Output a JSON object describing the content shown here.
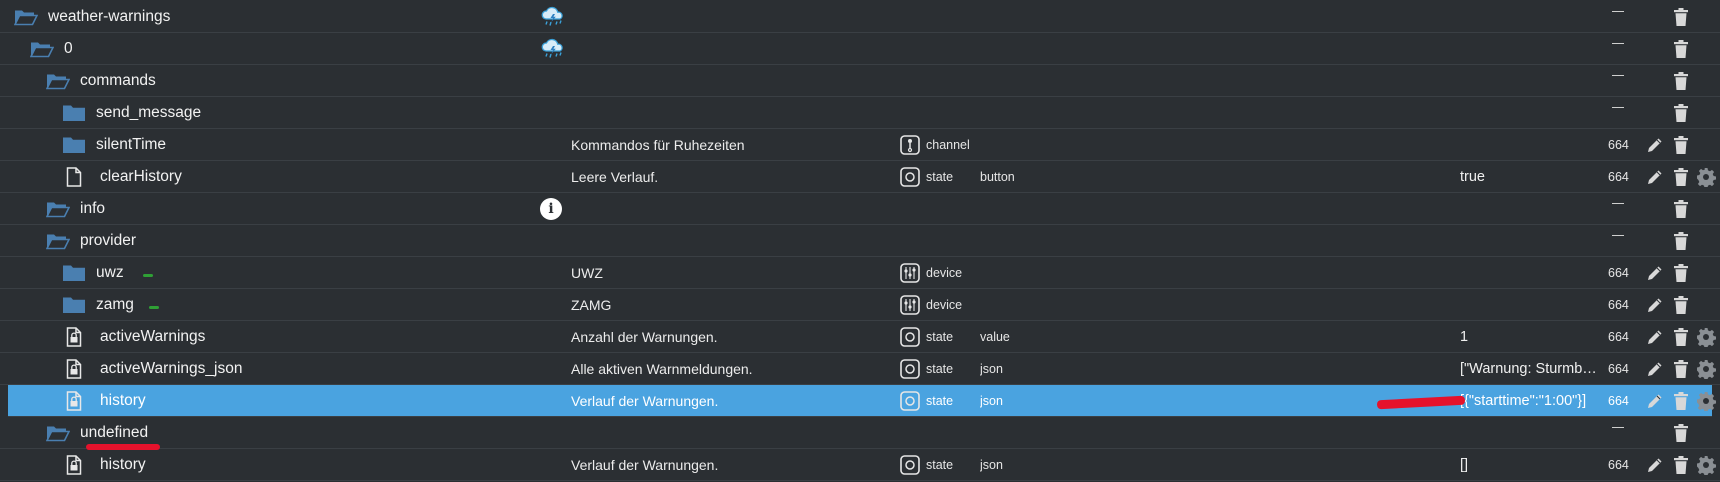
{
  "accent": "#4aa3e0",
  "annotation_color": "#e5122c",
  "rows": [
    {
      "name": "weather-warnings",
      "desc": "",
      "type": "",
      "role": "",
      "value": "",
      "acl": "",
      "icon": "folder-open-icon",
      "adapter_icon": "weather-icon"
    },
    {
      "name": "0",
      "desc": "",
      "type": "",
      "role": "",
      "value": "",
      "acl": "",
      "icon": "folder-open-icon",
      "adapter_icon": "weather-icon"
    },
    {
      "name": "commands",
      "desc": "",
      "type": "",
      "role": "",
      "value": "",
      "acl": "",
      "icon": "folder-open-icon"
    },
    {
      "name": "send_message",
      "desc": "",
      "type": "",
      "role": "",
      "value": "",
      "acl": "",
      "icon": "folder-icon"
    },
    {
      "name": "silentTime",
      "desc": "Kommandos für Ruhezeiten",
      "type": "channel",
      "role": "",
      "value": "",
      "acl": "664",
      "icon": "folder-icon",
      "type_icon": "channel-icon"
    },
    {
      "name": "clearHistory",
      "desc": "Leere Verlauf.",
      "type": "state",
      "role": "button",
      "value": "true",
      "acl": "664",
      "icon": "file-icon",
      "type_icon": "state-icon"
    },
    {
      "name": "info",
      "desc": "",
      "type": "",
      "role": "",
      "value": "",
      "acl": "",
      "icon": "folder-open-icon",
      "adapter_icon": "info-icon"
    },
    {
      "name": "provider",
      "desc": "",
      "type": "",
      "role": "",
      "value": "",
      "acl": "",
      "icon": "folder-open-icon"
    },
    {
      "name": "uwz",
      "desc": "UWZ",
      "type": "device",
      "role": "",
      "value": "",
      "acl": "664",
      "icon": "folder-icon",
      "type_icon": "device-icon"
    },
    {
      "name": "zamg",
      "desc": "ZAMG",
      "type": "device",
      "role": "",
      "value": "",
      "acl": "664",
      "icon": "folder-icon",
      "type_icon": "device-icon"
    },
    {
      "name": "activeWarnings",
      "desc": "Anzahl der Warnungen.",
      "type": "state",
      "role": "value",
      "value": "1",
      "acl": "664",
      "icon": "lock-file-icon",
      "type_icon": "state-icon"
    },
    {
      "name": "activeWarnings_json",
      "desc": "Alle aktiven Warnmeldungen.",
      "type": "state",
      "role": "json",
      "value": "[\"Warnung: Sturmböen\"]",
      "acl": "664",
      "icon": "lock-file-icon",
      "type_icon": "state-icon"
    },
    {
      "name": "history",
      "desc": "Verlauf der Warnungen.",
      "type": "state",
      "role": "json",
      "value": "[{\"starttime\":\"1:00\"}]",
      "acl": "664",
      "icon": "lock-file-icon",
      "type_icon": "state-icon"
    },
    {
      "name": "undefined",
      "desc": "",
      "type": "",
      "role": "",
      "value": "",
      "acl": "",
      "icon": "folder-open-icon"
    },
    {
      "name": "history",
      "desc": "Verlauf der Warnungen.",
      "type": "state",
      "role": "json",
      "value": "[]",
      "acl": "664",
      "icon": "lock-file-icon",
      "type_icon": "state-icon"
    }
  ]
}
